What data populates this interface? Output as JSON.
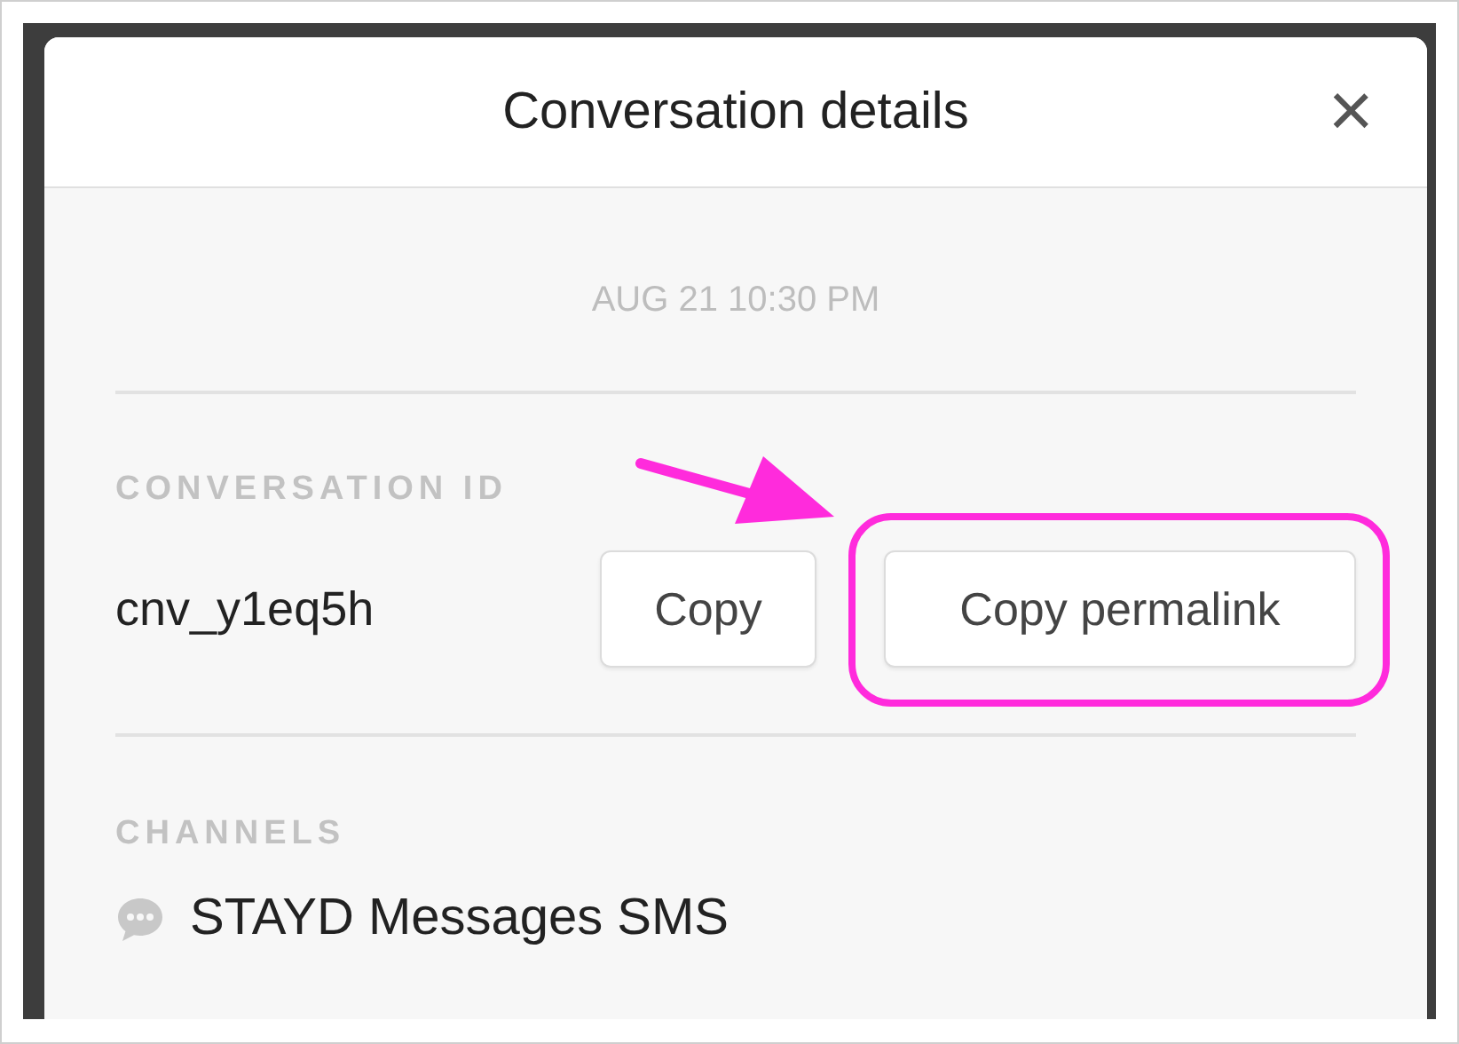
{
  "dialog": {
    "title": "Conversation details",
    "close": "×"
  },
  "timestamp": "AUG 21 10:30 PM",
  "conversation_id": {
    "label": "CONVERSATION ID",
    "value": "cnv_y1eq5h",
    "buttons": [
      "Copy",
      "Copy permalink"
    ]
  },
  "channels": {
    "label": "CHANNELS",
    "items": [
      {
        "name": "STAYD Messages SMS"
      }
    ]
  }
}
